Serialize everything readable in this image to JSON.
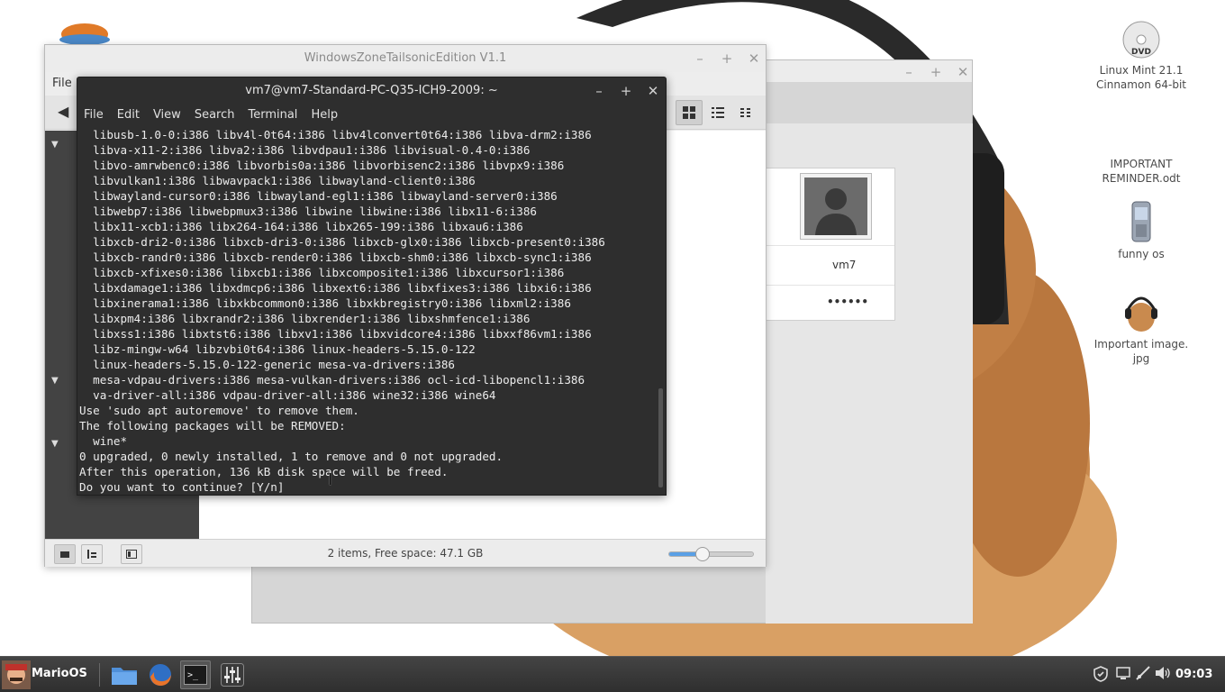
{
  "desktop": {
    "icons": [
      {
        "label": "Linux Mint 21.1\nCinnamon 64-bit",
        "icon": "dvd-icon"
      },
      {
        "label": "IMPORTANT\nREMINDER.odt",
        "icon": "document-icon"
      },
      {
        "label": "funny os",
        "icon": "phone-icon"
      },
      {
        "label": "Important image.\njpg",
        "icon": "image-icon"
      }
    ]
  },
  "files_window": {
    "title": "WindowsZoneTailsonicEdition V1.1",
    "menu_file": "File",
    "status": "2 items, Free space: 47.1 GB",
    "zoom_level": 0.4
  },
  "user_card": {
    "username": "vm7",
    "password_mask": "••••••"
  },
  "terminal": {
    "title": "vm7@vm7-Standard-PC-Q35-ICH9-2009: ~",
    "menu": [
      "File",
      "Edit",
      "View",
      "Search",
      "Terminal",
      "Help"
    ],
    "lines": [
      "  libusb-1.0-0:i386 libv4l-0t64:i386 libv4lconvert0t64:i386 libva-drm2:i386",
      "  libva-x11-2:i386 libva2:i386 libvdpau1:i386 libvisual-0.4-0:i386",
      "  libvo-amrwbenc0:i386 libvorbis0a:i386 libvorbisenc2:i386 libvpx9:i386",
      "  libvulkan1:i386 libwavpack1:i386 libwayland-client0:i386",
      "  libwayland-cursor0:i386 libwayland-egl1:i386 libwayland-server0:i386",
      "  libwebp7:i386 libwebpmux3:i386 libwine libwine:i386 libx11-6:i386",
      "  libx11-xcb1:i386 libx264-164:i386 libx265-199:i386 libxau6:i386",
      "  libxcb-dri2-0:i386 libxcb-dri3-0:i386 libxcb-glx0:i386 libxcb-present0:i386",
      "  libxcb-randr0:i386 libxcb-render0:i386 libxcb-shm0:i386 libxcb-sync1:i386",
      "  libxcb-xfixes0:i386 libxcb1:i386 libxcomposite1:i386 libxcursor1:i386",
      "  libxdamage1:i386 libxdmcp6:i386 libxext6:i386 libxfixes3:i386 libxi6:i386",
      "  libxinerama1:i386 libxkbcommon0:i386 libxkbregistry0:i386 libxml2:i386",
      "  libxpm4:i386 libxrandr2:i386 libxrender1:i386 libxshmfence1:i386",
      "  libxss1:i386 libxtst6:i386 libxv1:i386 libxvidcore4:i386 libxxf86vm1:i386",
      "  libz-mingw-w64 libzvbi0t64:i386 linux-headers-5.15.0-122",
      "  linux-headers-5.15.0-122-generic mesa-va-drivers:i386",
      "  mesa-vdpau-drivers:i386 mesa-vulkan-drivers:i386 ocl-icd-libopencl1:i386",
      "  va-driver-all:i386 vdpau-driver-all:i386 wine32:i386 wine64",
      "Use 'sudo apt autoremove' to remove them.",
      "The following packages will be REMOVED:",
      "  wine*",
      "0 upgraded, 0 newly installed, 1 to remove and 0 not upgraded.",
      "After this operation, 136 kB disk space will be freed.",
      "Do you want to continue? [Y/n] "
    ]
  },
  "taskbar": {
    "menu_label": "MarioOS",
    "clock": "09:03",
    "apps": [
      "files-icon",
      "firefox-icon",
      "terminal-icon",
      "mixer-icon"
    ]
  },
  "colors": {
    "terminal_bg": "#2e2e2e",
    "sidebar_bg": "#434343",
    "taskbar_bg": "#333333",
    "accent": "#5aa0e6"
  }
}
